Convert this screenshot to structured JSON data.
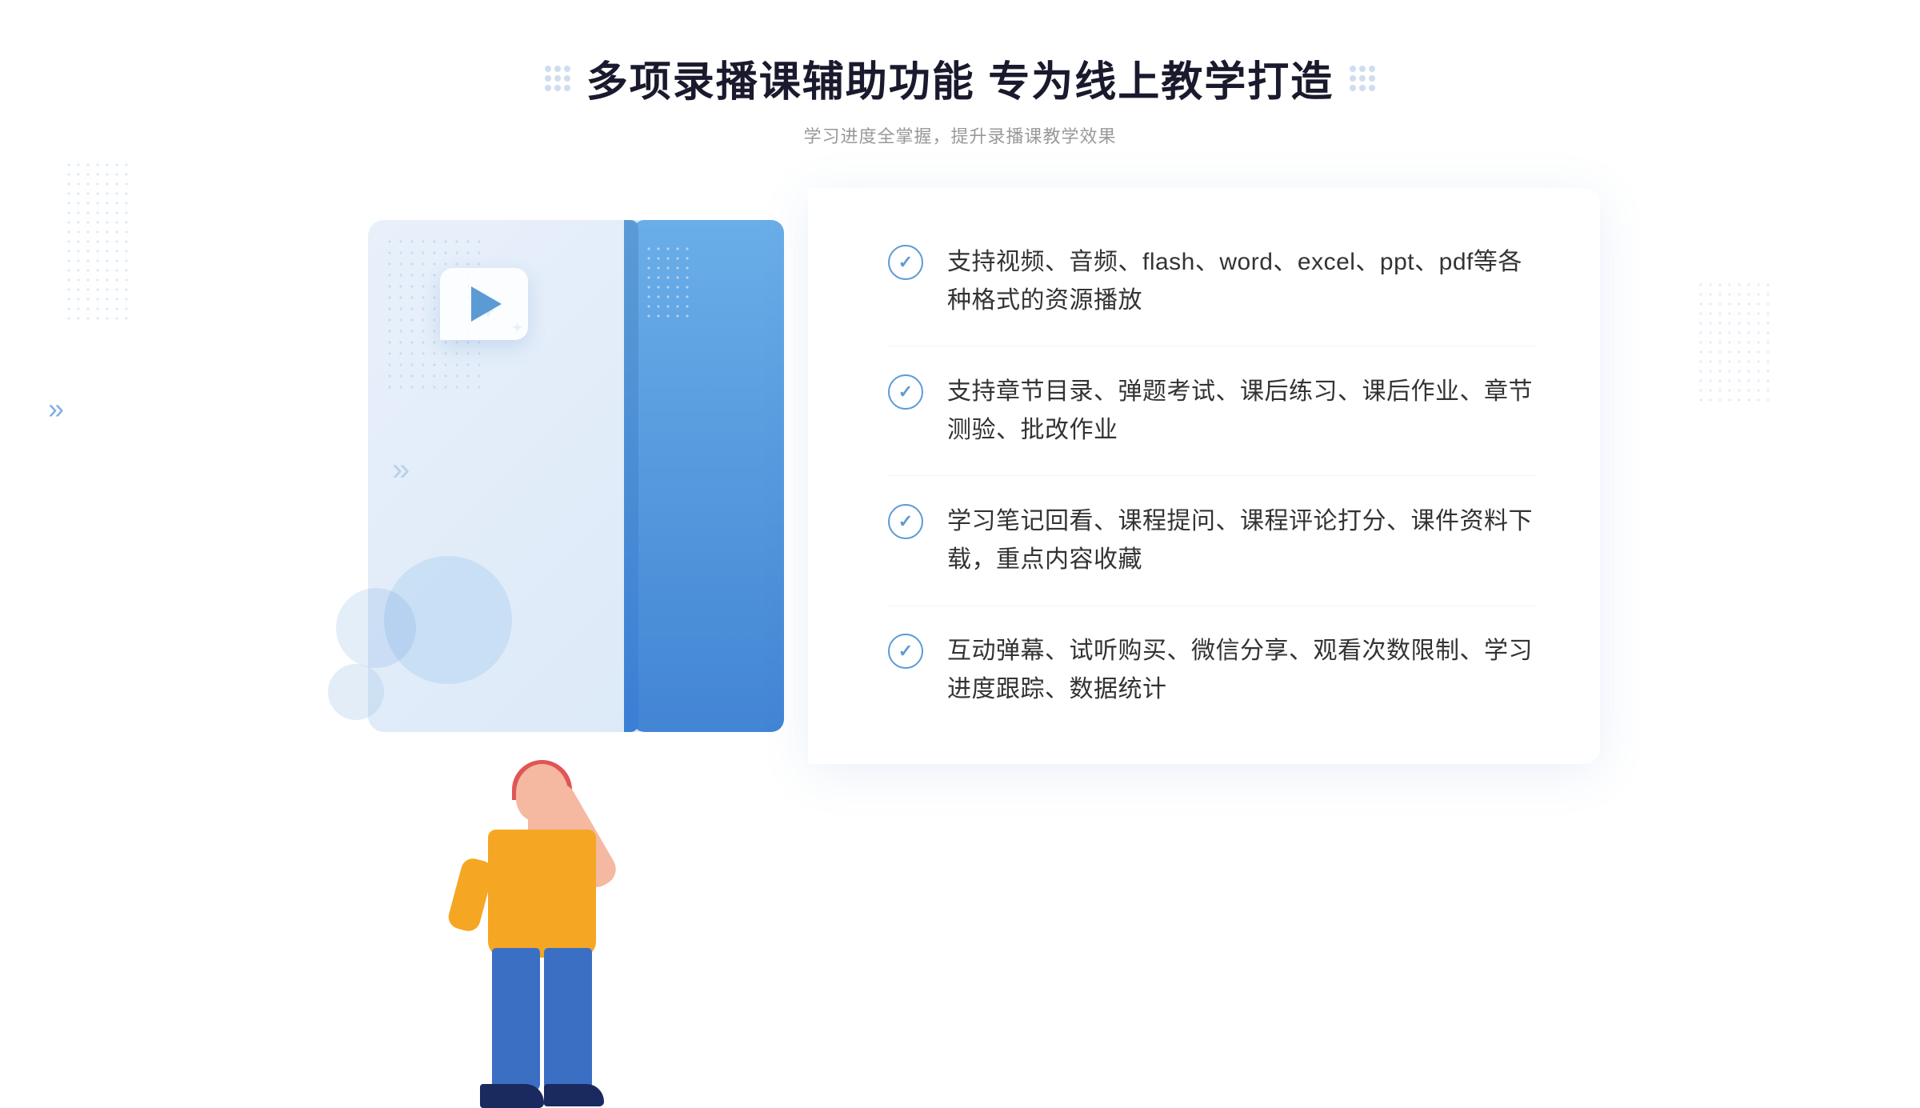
{
  "header": {
    "title": "多项录播课辅助功能 专为线上教学打造",
    "subtitle": "学习进度全掌握，提升录播课教学效果",
    "decorator_left": "⁛",
    "decorator_right": "⁛"
  },
  "features": [
    {
      "id": "feature-1",
      "text": "支持视频、音频、flash、word、excel、ppt、pdf等各种格式的资源播放"
    },
    {
      "id": "feature-2",
      "text": "支持章节目录、弹题考试、课后练习、课后作业、章节测验、批改作业"
    },
    {
      "id": "feature-3",
      "text": "学习笔记回看、课程提问、课程评论打分、课件资料下载，重点内容收藏"
    },
    {
      "id": "feature-4",
      "text": "互动弹幕、试听购买、微信分享、观看次数限制、学习进度跟踪、数据统计"
    }
  ],
  "chevron_left": "»",
  "play_icon": "▶"
}
